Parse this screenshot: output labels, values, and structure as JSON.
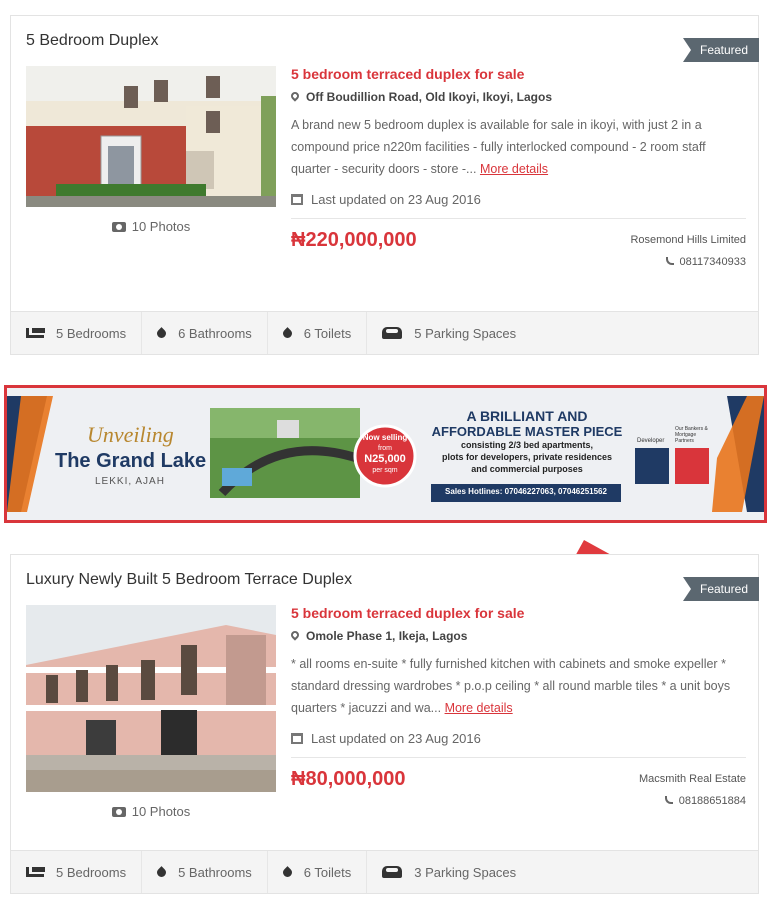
{
  "listings": [
    {
      "title": "5 Bedroom Duplex",
      "badge": "Featured",
      "photos_label": "10 Photos",
      "headline": "5 bedroom terraced duplex for sale",
      "address": "Off Boudillion Road, Old Ikoyi, Ikoyi, Lagos",
      "description": "A brand new 5 bedroom duplex is available for sale in ikoyi, with just 2 in a compound price n220m facilities - fully interlocked compound - 2 room staff quarter - security doors - store -...",
      "more_label": "More details",
      "updated": "Last updated on 23 Aug 2016",
      "price": "₦220,000,000",
      "agent": "Rosemond Hills Limited",
      "phone": "08117340933",
      "features": [
        "5 Bedrooms",
        "6 Bathrooms",
        "6 Toilets",
        "5 Parking Spaces"
      ]
    },
    {
      "title": "Luxury Newly Built 5 Bedroom Terrace Duplex",
      "badge": "Featured",
      "photos_label": "10 Photos",
      "headline": "5 bedroom terraced duplex for sale",
      "address": "Omole Phase 1, Ikeja, Lagos",
      "description": "* all rooms en-suite * fully furnished kitchen with cabinets and smoke expeller * standard dressing wardrobes * p.o.p ceiling * all round marble tiles * a unit boys quarters * jacuzzi and wa...",
      "more_label": "More details",
      "updated": "Last updated on 23 Aug 2016",
      "price": "₦80,000,000",
      "agent": "Macsmith Real Estate",
      "phone": "08188651884",
      "features": [
        "5 Bedrooms",
        "5 Bathrooms",
        "6 Toilets",
        "3 Parking Spaces"
      ]
    }
  ],
  "banner": {
    "unveiling": "Unveiling",
    "project": "The Grand Lake",
    "location": "LEKKI, AJAH",
    "now_selling": "Now selling",
    "from": "from",
    "price": "N25,000",
    "per": "per sqm",
    "tagline_1": "A BRILLIANT AND",
    "tagline_2": "AFFORDABLE MASTER PIECE",
    "body_1": "consisting 2/3 bed apartments,",
    "body_2": "plots for developers, private residences",
    "body_3": "and commercial purposes",
    "hotlines": "Sales Hotlines: 07046227063, 07046251562",
    "developer": "Developer",
    "partners": "Our Bankers & Mortgage Partners"
  },
  "colors": {
    "accent": "#d9353b",
    "badge": "#5b6770",
    "banner_navy": "#1f3a64",
    "banner_orange": "#e8741c"
  }
}
